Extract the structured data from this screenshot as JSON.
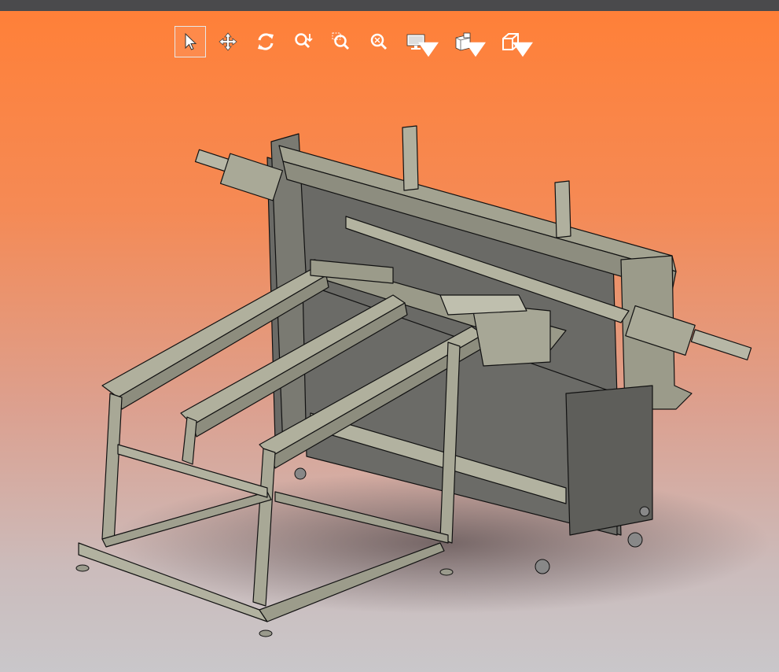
{
  "window": {
    "topbar_color": "#4a4a4c"
  },
  "toolbar": {
    "tools": [
      {
        "id": "select",
        "icon": "arrow-pointer-icon",
        "active": true
      },
      {
        "id": "pan",
        "icon": "move-arrows-icon",
        "active": false
      },
      {
        "id": "rotate",
        "icon": "rotate-icon",
        "active": false
      },
      {
        "id": "zoom",
        "icon": "zoom-icon",
        "active": false
      },
      {
        "id": "zoom-window",
        "icon": "zoom-window-icon",
        "active": false
      },
      {
        "id": "fit-all",
        "icon": "fit-all-icon",
        "active": false
      },
      {
        "id": "display",
        "icon": "monitor-icon",
        "dropdown": true
      },
      {
        "id": "views",
        "icon": "standard-views-icon",
        "dropdown": true
      },
      {
        "id": "view-mode",
        "icon": "cube-icon",
        "dropdown": true
      }
    ]
  },
  "viewport": {
    "background_top": "#ff8038",
    "background_bottom": "#c9c7ca",
    "model_name": "machine-frame-assembly",
    "model_color": "#a3a391"
  }
}
